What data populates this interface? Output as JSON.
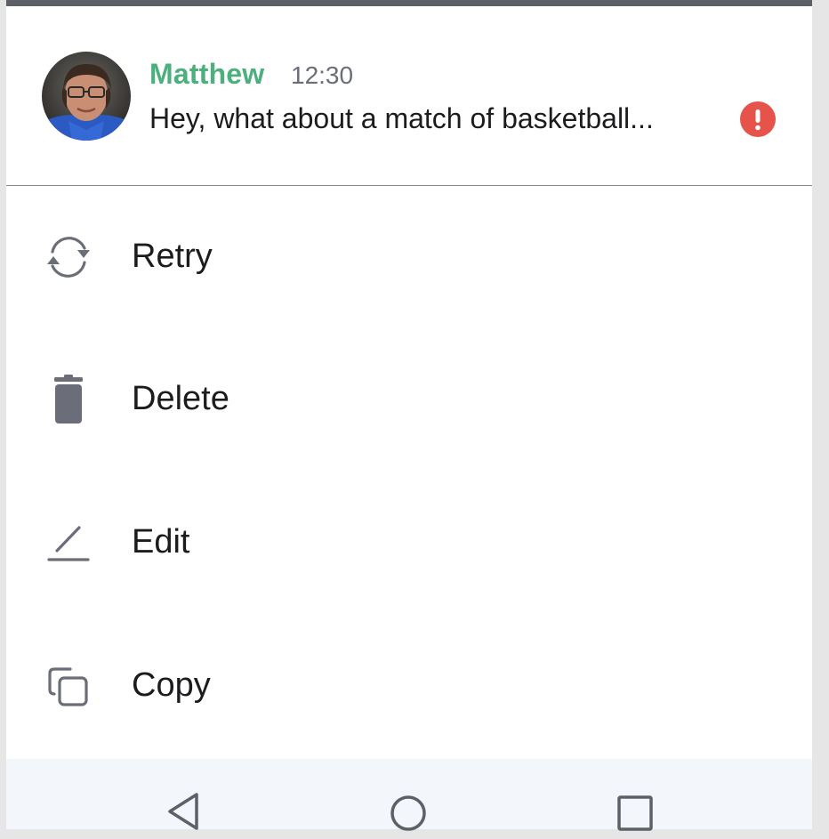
{
  "message": {
    "sender": "Matthew",
    "time": "12:30",
    "text": "Hey, what about a match of basketball...",
    "status_icon": "error-icon",
    "sender_color": "#4caf7d",
    "error_color": "#e5534b"
  },
  "menu": {
    "items": [
      {
        "label": "Retry",
        "icon": "retry-icon"
      },
      {
        "label": "Delete",
        "icon": "trash-icon"
      },
      {
        "label": "Edit",
        "icon": "pencil-icon"
      },
      {
        "label": "Copy",
        "icon": "copy-icon"
      }
    ],
    "icon_color": "#6b6e78"
  },
  "navbar": {
    "buttons": [
      "back-icon",
      "home-icon",
      "recents-icon"
    ]
  }
}
